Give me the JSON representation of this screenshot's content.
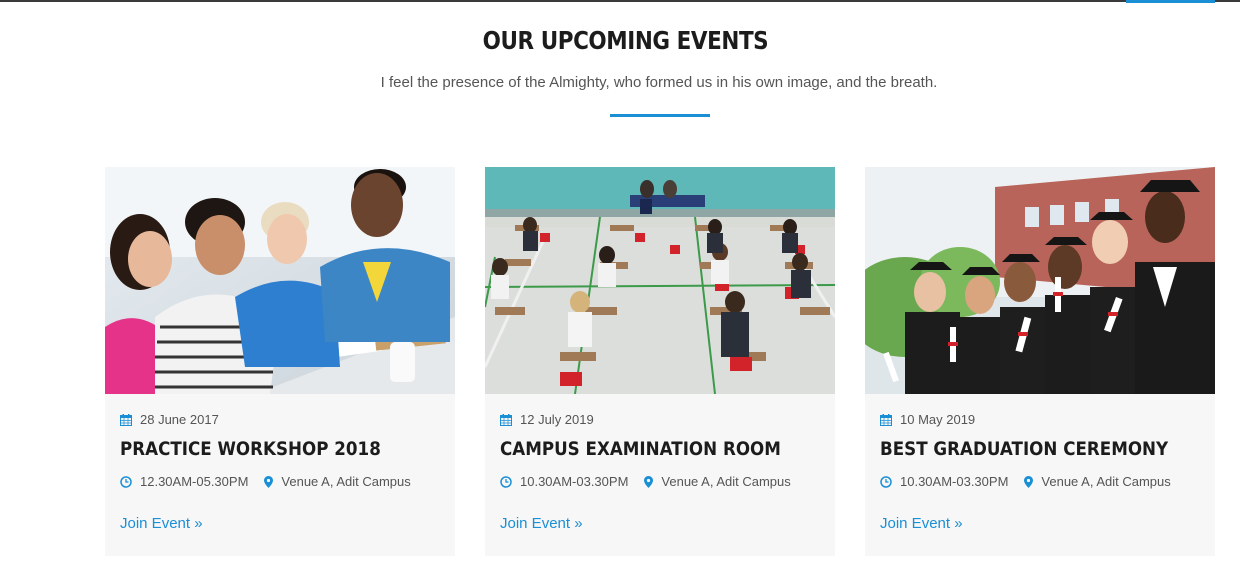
{
  "section": {
    "heading": "OUR UPCOMING EVENTS",
    "subtitle": "I feel the presence of the Almighty, who formed us in his own image, and the breath."
  },
  "colors": {
    "accent": "#1a8fd6",
    "heading": "#1c1c1c",
    "text": "#555555",
    "card_bg": "#f7f7f7"
  },
  "events": [
    {
      "date": "28 June 2017",
      "title": "PRACTICE WORKSHOP 2018",
      "time": "12.30AM-05.30PM",
      "venue": "Venue A, Adit Campus",
      "cta": "Join Event »",
      "image_icon": "students-discussion-photo"
    },
    {
      "date": "12 July 2019",
      "title": "CAMPUS EXAMINATION ROOM",
      "time": "10.30AM-03.30PM",
      "venue": "Venue A, Adit Campus",
      "cta": "Join Event »",
      "image_icon": "exam-hall-photo"
    },
    {
      "date": "10 May 2019",
      "title": "BEST GRADUATION CEREMONY",
      "time": "10.30AM-03.30PM",
      "venue": "Venue A, Adit Campus",
      "cta": "Join Event »",
      "image_icon": "graduates-photo"
    }
  ],
  "icons": {
    "date": "calendar-icon",
    "time": "clock-icon",
    "venue": "map-pin-icon"
  }
}
